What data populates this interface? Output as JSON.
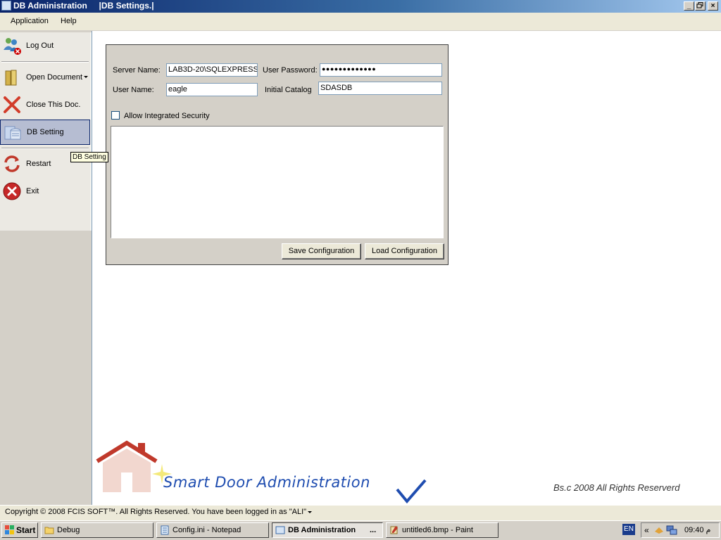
{
  "window": {
    "title": "DB Administration     |DB Settings.|"
  },
  "menu": {
    "items": [
      "Application",
      "Help"
    ]
  },
  "sidebar": {
    "items": [
      {
        "label": "Log Out"
      },
      {
        "label": "Open Document"
      },
      {
        "label": "Close This Doc."
      },
      {
        "label": "DB Setting"
      },
      {
        "label": "Restart"
      },
      {
        "label": "Exit"
      }
    ],
    "tooltip": "DB Setting"
  },
  "db_settings": {
    "server_name_label": "Server Name:",
    "server_name_value": "LAB3D-20\\SQLEXPRESS",
    "user_password_label": "User Password:",
    "user_password_value": "●●●●●●●●●●●●●",
    "user_name_label": "User Name:",
    "user_name_value": "eagle",
    "initial_catalog_label": "Initial Catalog",
    "initial_catalog_value": "SDASDB",
    "integrated_security_label": "Allow Integrated Security",
    "integrated_security_checked": false,
    "save_button": "Save Configuration",
    "load_button": "Load Configuration"
  },
  "branding": {
    "logo_text": "Smart Door Administration",
    "rights": "Bs.c 2008  All Rights Reserverd"
  },
  "status": {
    "text": "Copyright © 2008 FCIS SOFT™. All Rights Reserved.   You have been logged in as \"ALI\""
  },
  "taskbar": {
    "start": "Start",
    "buttons": [
      {
        "label": "Debug"
      },
      {
        "label": "Config.ini - Notepad"
      },
      {
        "label": "DB Administration"
      },
      {
        "label": "untitled6.bmp - Paint"
      }
    ],
    "active_ellipsis": "...",
    "language": "EN",
    "tray_chevron": "«",
    "clock": "09:40 م"
  },
  "colors": {
    "titlebar": "#0a246a",
    "logo_blue": "#1f4db0",
    "house_red": "#c0392b"
  }
}
